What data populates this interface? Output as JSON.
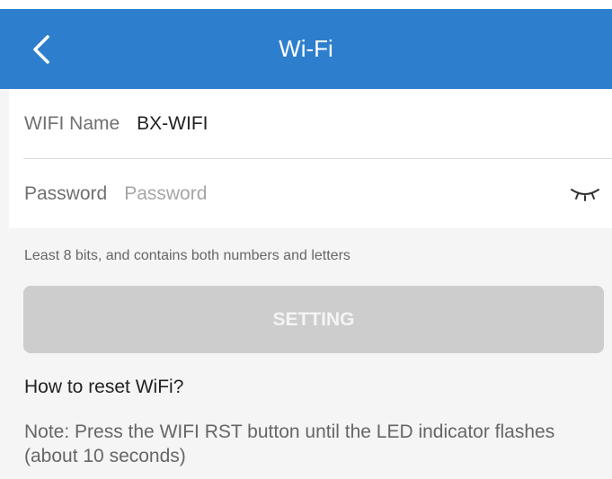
{
  "app_bar": {
    "title": "Wi-Fi",
    "background_color": "#2d7fcd",
    "back_icon": "chevron-left-icon"
  },
  "form": {
    "wifi_name": {
      "label": "WIFI Name",
      "value": "BX-WIFI"
    },
    "password": {
      "label": "Password",
      "value": "",
      "placeholder": "Password",
      "toggle_icon": "eye-closed-icon"
    }
  },
  "hint": "Least 8 bits, and contains both numbers and letters",
  "setting_button": {
    "label": "SETTING",
    "enabled": false
  },
  "help": {
    "heading": "How to reset WiFi?",
    "note": "Note: Press the WIFI RST button until the LED indicator flashes (about 10 seconds)"
  }
}
